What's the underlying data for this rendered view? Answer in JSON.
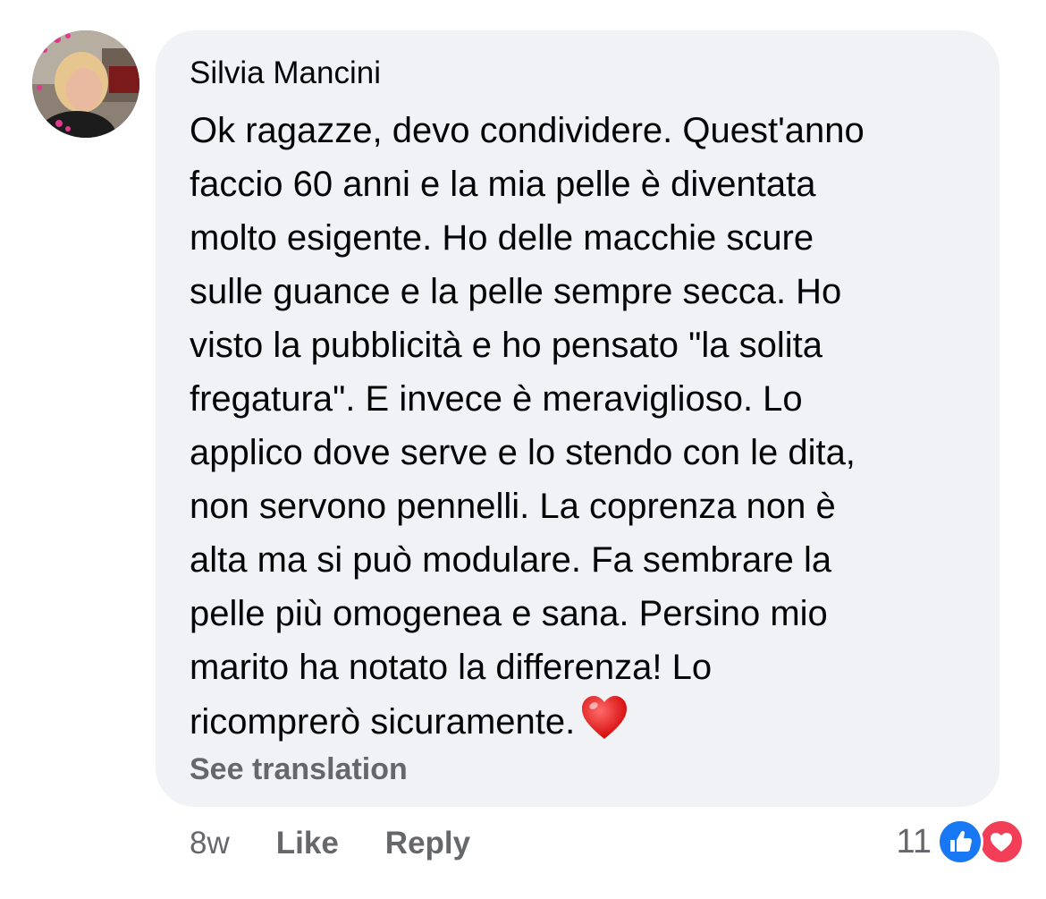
{
  "comment": {
    "author": "Silvia Mancini",
    "text_lines": [
      "Ok ragazze, devo condividere. Quest'anno",
      "faccio 60 anni e la mia pelle è diventata",
      "molto esigente. Ho delle macchie scure",
      "sulle guance e la pelle sempre secca. Ho",
      "visto la pubblicità e ho pensato \"la solita",
      "fregatura\". E invece è meraviglioso. Lo",
      "applico dove serve e lo stendo con le dita,",
      "non servono pennelli. La coprenza non è",
      "alta ma si può modulare. Fa sembrare la",
      "pelle più omogenea e sana. Persino mio",
      "marito ha notato la differenza! Lo",
      "ricomprerò sicuramente."
    ],
    "trailing_emoji": "heart-icon",
    "see_translation": "See translation"
  },
  "meta": {
    "time": "8w",
    "like_label": "Like",
    "reply_label": "Reply"
  },
  "reactions": {
    "count": "11",
    "types": [
      "like-reaction-icon",
      "love-reaction-icon"
    ],
    "colors": {
      "like": "#1877f2",
      "love": "#f33e58"
    }
  },
  "colors": {
    "bubble": "#f0f2f5",
    "text": "#050505",
    "secondary": "#65676b"
  }
}
